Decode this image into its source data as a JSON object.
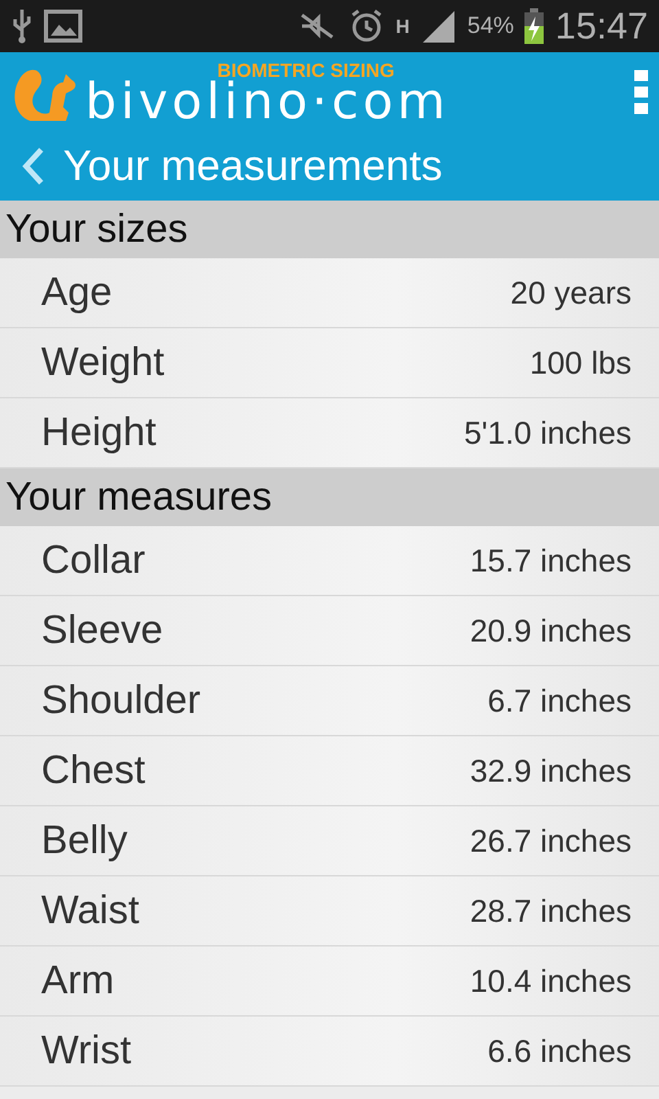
{
  "status_bar": {
    "network": "H",
    "battery": "54%",
    "time": "15:47"
  },
  "header": {
    "logo": "bivolino·com",
    "tagline": "BIOMETRIC SIZING",
    "title": "Your measurements"
  },
  "sections": [
    {
      "title": "Your sizes",
      "rows": [
        {
          "label": "Age",
          "value": "20 years"
        },
        {
          "label": "Weight",
          "value": "100 lbs"
        },
        {
          "label": "Height",
          "value": "5'1.0 inches"
        }
      ]
    },
    {
      "title": "Your measures",
      "rows": [
        {
          "label": "Collar",
          "value": "15.7 inches"
        },
        {
          "label": "Sleeve",
          "value": "20.9 inches"
        },
        {
          "label": "Shoulder",
          "value": "6.7 inches"
        },
        {
          "label": "Chest",
          "value": "32.9 inches"
        },
        {
          "label": "Belly",
          "value": "26.7 inches"
        },
        {
          "label": "Waist",
          "value": "28.7 inches"
        },
        {
          "label": "Arm",
          "value": "10.4 inches"
        },
        {
          "label": "Wrist",
          "value": "6.6 inches"
        }
      ]
    }
  ]
}
